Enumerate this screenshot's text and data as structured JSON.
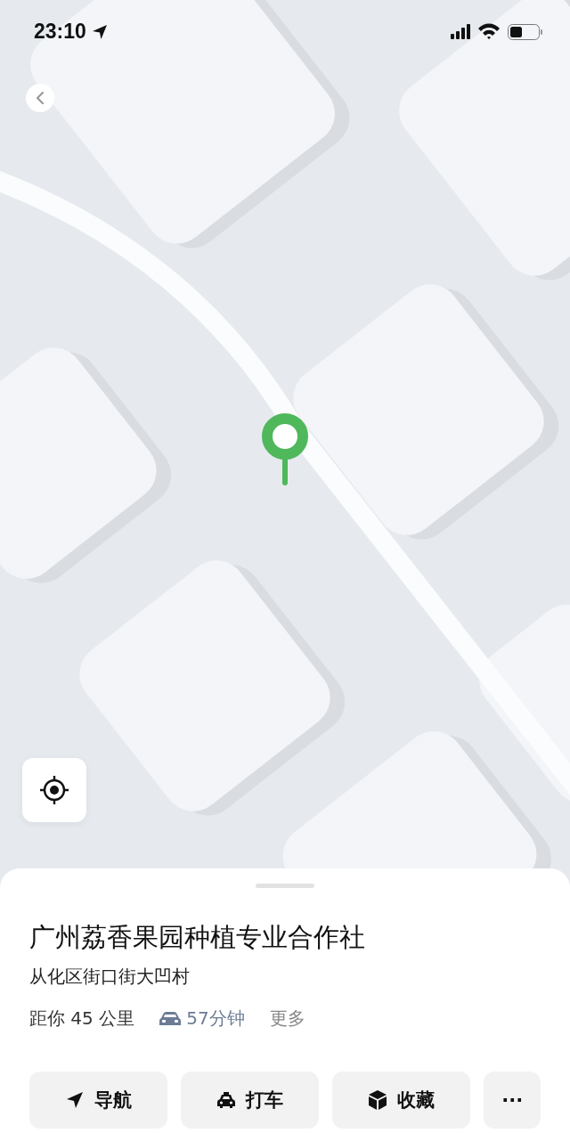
{
  "status_bar": {
    "time": "23:10"
  },
  "place": {
    "name": "广州荔香果园种植专业合作社",
    "address": "从化区街口街大凹村",
    "distance": "距你 45 公里",
    "drive_time": "57分钟",
    "more": "更多"
  },
  "actions": [
    {
      "kind": "navigate",
      "label": "导航"
    },
    {
      "kind": "taxi",
      "label": "打车"
    },
    {
      "kind": "favorite",
      "label": "收藏"
    },
    {
      "kind": "more",
      "label": "···"
    }
  ]
}
